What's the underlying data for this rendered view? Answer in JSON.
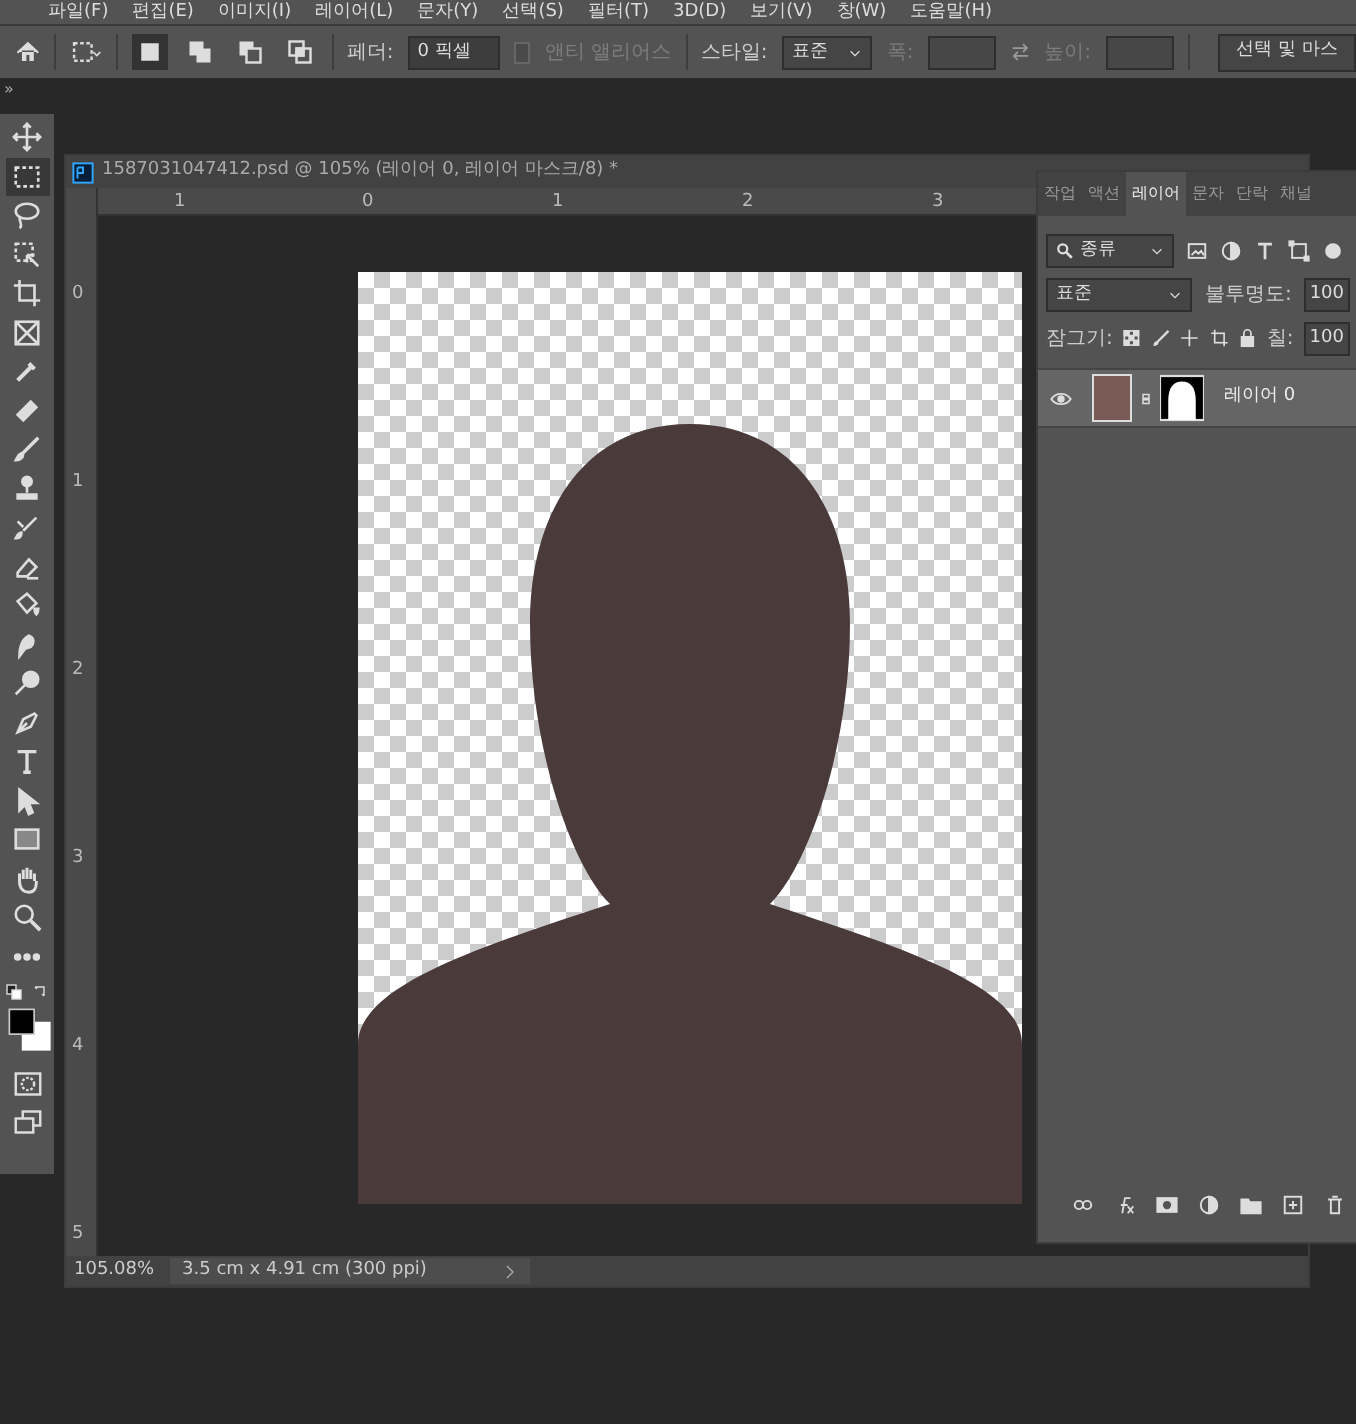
{
  "menu": [
    "파일(F)",
    "편집(E)",
    "이미지(I)",
    "레이어(L)",
    "문자(Y)",
    "선택(S)",
    "필터(T)",
    "3D(D)",
    "보기(V)",
    "창(W)",
    "도움말(H)"
  ],
  "options_bar": {
    "selection_modes": [
      {
        "selected": true
      },
      {
        "selected": false
      },
      {
        "selected": false
      },
      {
        "selected": false
      }
    ],
    "feather_label": "페더:",
    "feather_value": "0 픽셀",
    "anti_alias": {
      "label": "앤티 앨리어스",
      "checked": false,
      "disabled": true
    },
    "style_label": "스타일:",
    "style_value": "표준",
    "width_field": {
      "label": "폭:",
      "disabled": true
    },
    "height_field": {
      "label": "높이:",
      "disabled": true
    },
    "select_mask_button": "선택 및 마스"
  },
  "toolbar": {
    "collapse": "»",
    "tools": [
      {
        "kind": "move",
        "selected": false
      },
      {
        "kind": "marquee",
        "selected": true
      },
      {
        "kind": "lasso",
        "selected": false
      },
      {
        "kind": "object-select",
        "selected": false
      },
      {
        "kind": "crop",
        "selected": false
      },
      {
        "kind": "frame",
        "selected": false
      },
      {
        "kind": "eyedropper",
        "selected": false
      },
      {
        "kind": "healing",
        "selected": false
      },
      {
        "kind": "brush",
        "selected": false
      },
      {
        "kind": "stamp",
        "selected": false
      },
      {
        "kind": "history-brush",
        "selected": false
      },
      {
        "kind": "eraser",
        "selected": false
      },
      {
        "kind": "bucket",
        "selected": false
      },
      {
        "kind": "smudge",
        "selected": false
      },
      {
        "kind": "dodge",
        "selected": false
      },
      {
        "kind": "pen",
        "selected": false
      },
      {
        "kind": "type",
        "selected": false
      },
      {
        "kind": "path-select",
        "selected": false
      },
      {
        "kind": "rectangle",
        "selected": false
      },
      {
        "kind": "hand",
        "selected": false
      },
      {
        "kind": "zoom",
        "selected": false
      },
      {
        "kind": "more",
        "selected": false
      }
    ]
  },
  "document": {
    "title": "1587031047412.psd @ 105% (레이어 0, 레이어 마스크/8) *",
    "h_ruler": [
      "1",
      "0",
      "1",
      "2",
      "3"
    ],
    "v_ruler": [
      "0",
      "1",
      "2",
      "3",
      "4",
      "5"
    ],
    "zoom": "105.08%",
    "doc_info": "3.5 cm x 4.91 cm (300 ppi)"
  },
  "layers_panel": {
    "tabs": [
      {
        "label": "작업",
        "selected": false
      },
      {
        "label": "액션",
        "selected": false
      },
      {
        "label": "레이어",
        "selected": true
      },
      {
        "label": "문자",
        "selected": false
      },
      {
        "label": "단락",
        "selected": false
      },
      {
        "label": "채널",
        "selected": false
      }
    ],
    "filter": "종류",
    "blend_mode": "표준",
    "opacity_label": "불투명도:",
    "opacity_value": "100",
    "lock_label": "잠그기:",
    "fill_label": "칠:",
    "fill_value": "100",
    "layers": [
      {
        "name": "레이어 0",
        "visible": true,
        "selected": true
      }
    ]
  }
}
